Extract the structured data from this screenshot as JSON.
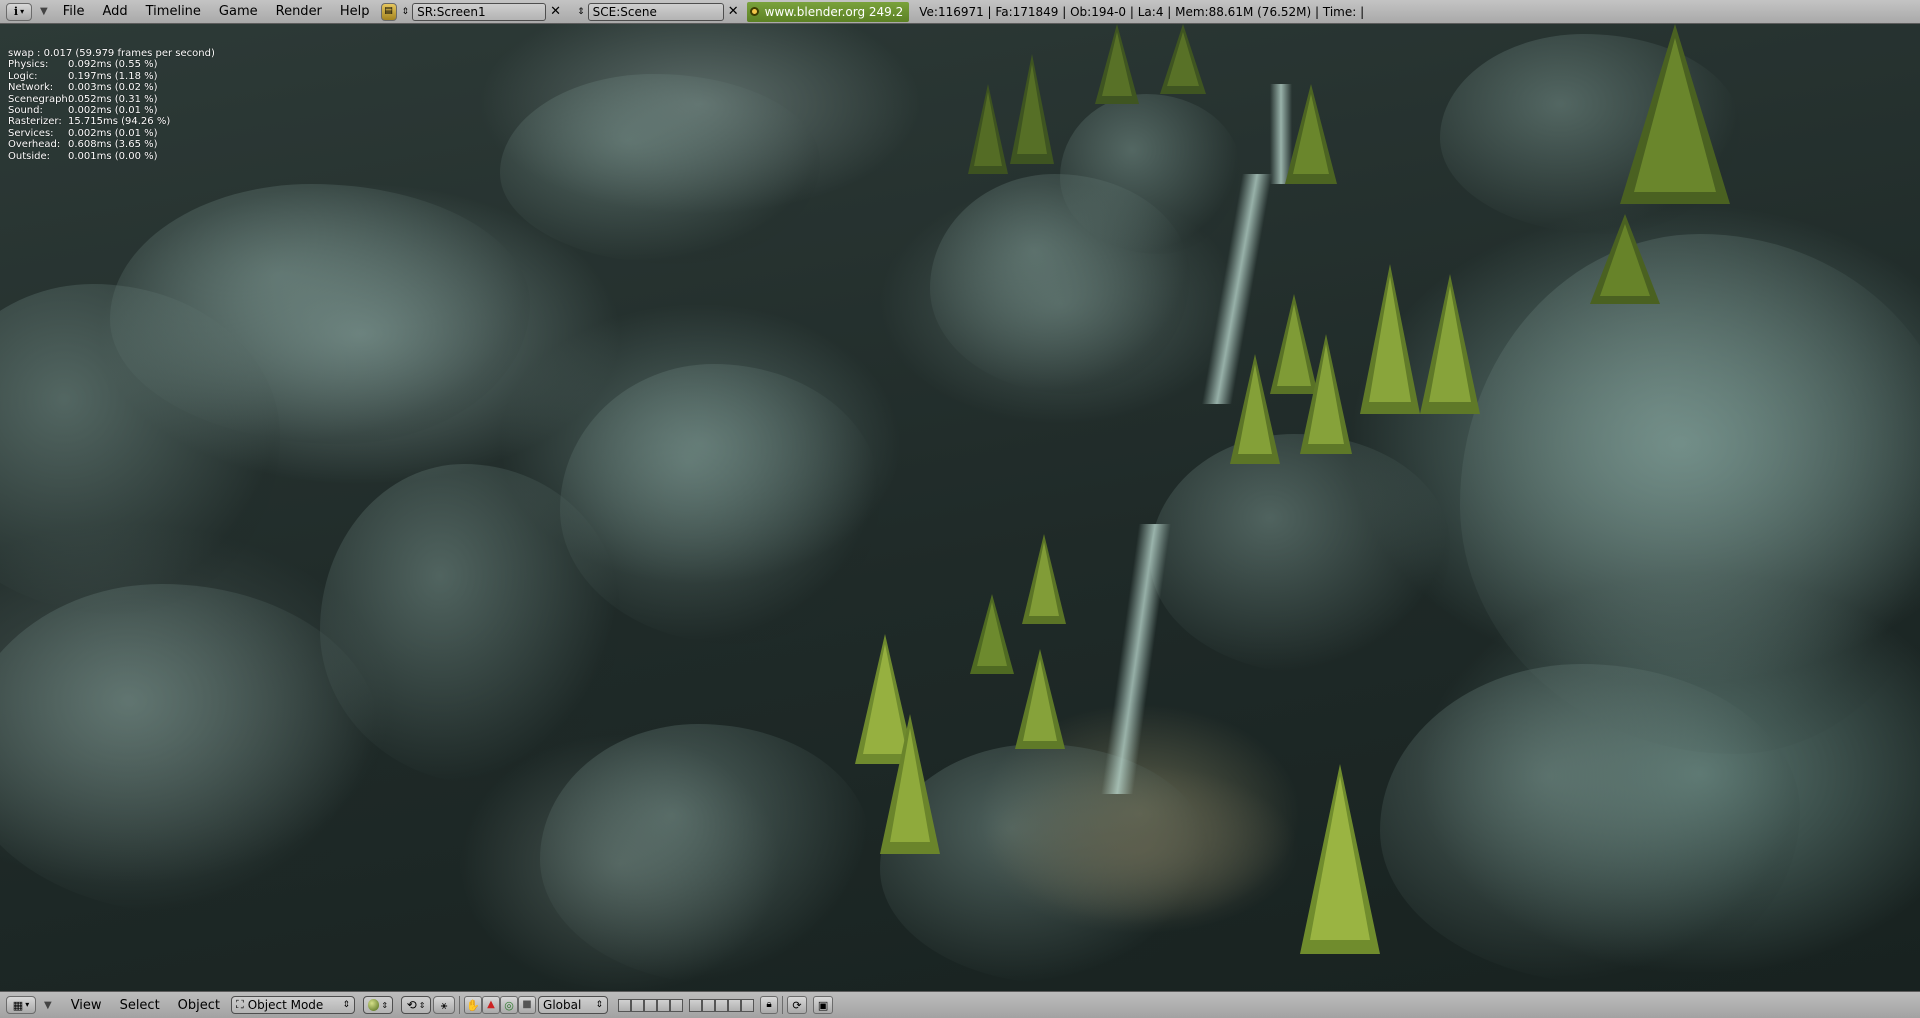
{
  "top_header": {
    "window_type_icon": "info-icon",
    "menus": [
      "File",
      "Add",
      "Timeline",
      "Game",
      "Render",
      "Help"
    ],
    "screen_browse_icon": "screen-browse-icon",
    "screen_field": "SR:Screen1",
    "scene_field": "SCE:Scene",
    "website": "www.blender.org 249.2",
    "stats_text": "Ve:116971 | Fa:171849 | Ob:194-0 | La:4  | Mem:88.61M (76.52M)  | Time: |"
  },
  "profiler": {
    "swap": "swap : 0.017 (59.979 frames per second)",
    "rows": [
      {
        "label": "Physics:",
        "value": "0.092ms (0.55 %)"
      },
      {
        "label": "Logic:",
        "value": "0.197ms (1.18 %)"
      },
      {
        "label": "Network:",
        "value": "0.003ms (0.02 %)"
      },
      {
        "label": "Scenegraph:",
        "value": "0.052ms (0.31 %)"
      },
      {
        "label": "Sound:",
        "value": "0.002ms (0.01 %)"
      },
      {
        "label": "Rasterizer:",
        "value": "15.715ms (94.26 %)"
      },
      {
        "label": "Services:",
        "value": "0.002ms (0.01 %)"
      },
      {
        "label": "Overhead:",
        "value": "0.608ms (3.65 %)"
      },
      {
        "label": "Outside:",
        "value": "0.001ms (0.00 %)"
      }
    ]
  },
  "bottom_header": {
    "window_type_icon": "grid-icon",
    "menus": [
      "View",
      "Select",
      "Object"
    ],
    "mode": "Object Mode",
    "orientation": "Global"
  }
}
